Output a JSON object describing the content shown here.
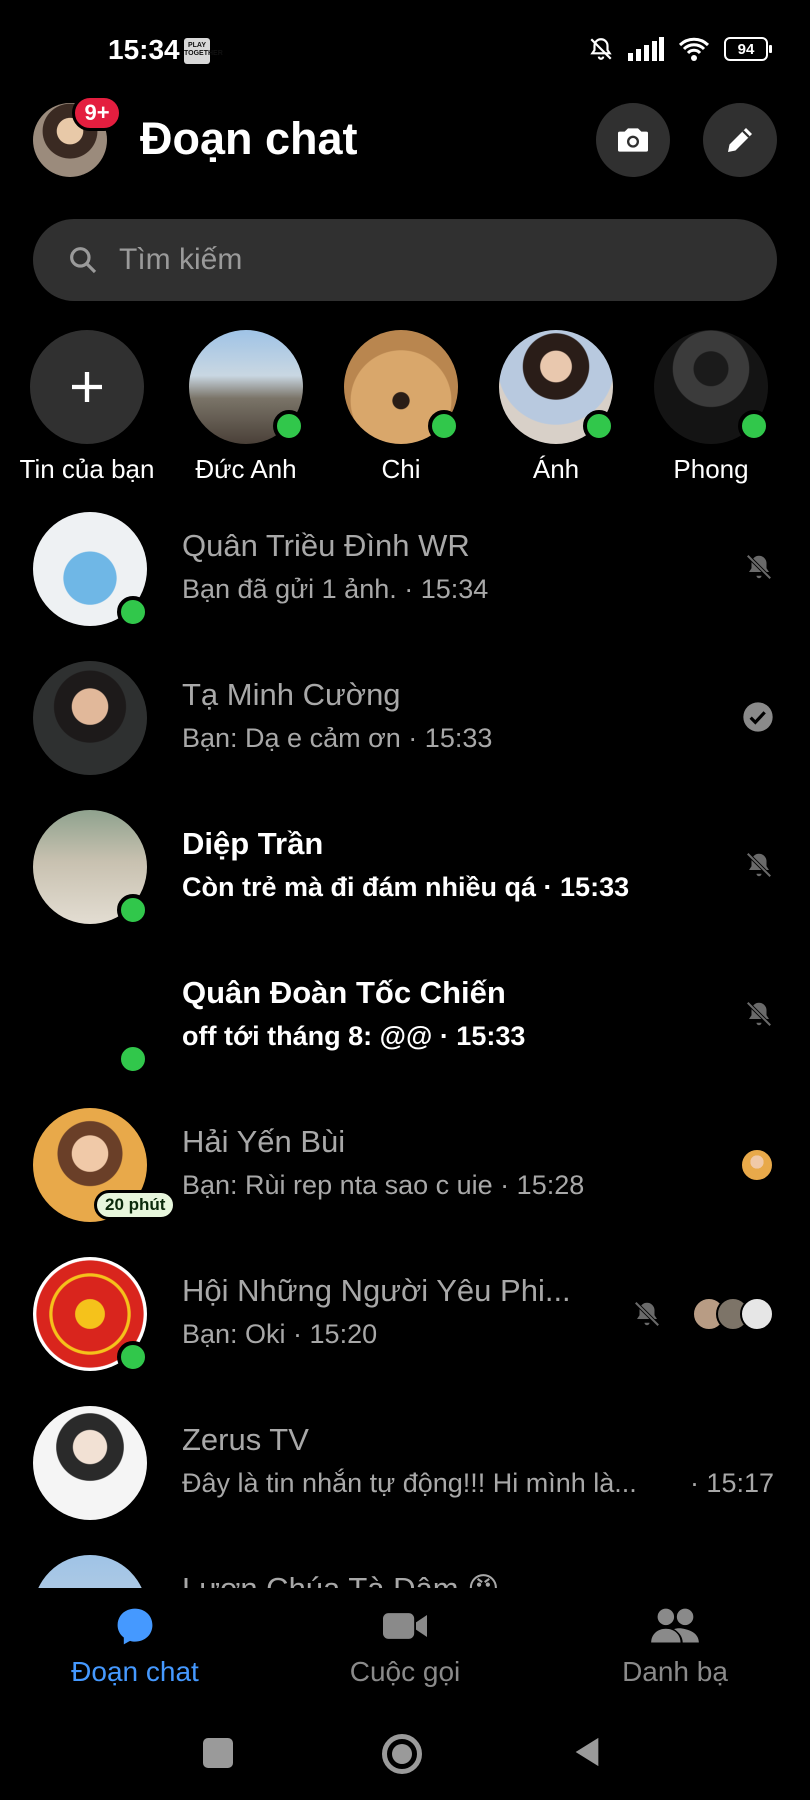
{
  "status_bar": {
    "time": "15:34",
    "app_tag": "PLAY TOGETHER",
    "battery": "94"
  },
  "header": {
    "title": "Đoạn chat",
    "notification_badge": "9+"
  },
  "search": {
    "placeholder": "Tìm kiếm"
  },
  "stories": [
    {
      "label": "Tin của bạn",
      "type": "add"
    },
    {
      "label": "Đức Anh",
      "online": true
    },
    {
      "label": "Chi",
      "online": true
    },
    {
      "label": "Ánh",
      "online": true
    },
    {
      "label": "Phong",
      "online": true
    }
  ],
  "chats": [
    {
      "name": "Quân Triều Đình WR",
      "preview": "Bạn đã gửi 1 ảnh. · 15:34",
      "unread": false,
      "online": true,
      "muted": true
    },
    {
      "name": "Tạ Minh Cường",
      "preview": "Bạn: Dạ e cảm ơn · 15:33",
      "unread": false,
      "online": false,
      "status": "sent"
    },
    {
      "name": "Diệp Trần",
      "preview": "Còn trẻ mà đi đám nhiều qá · 15:33",
      "unread": true,
      "online": true,
      "muted": true
    },
    {
      "name": "Quân Đoàn Tốc Chiến",
      "preview": "off tới tháng 8: @@ · 15:33",
      "unread": true,
      "online": true,
      "muted": true
    },
    {
      "name": "Hải Yến Bùi",
      "preview": "Bạn: Rùi rep nta sao c uie · 15:28",
      "unread": false,
      "active_badge": "20 phút",
      "status": "seen"
    },
    {
      "name": "Hội Những Người Yêu Phi...",
      "preview": "Bạn: Oki · 15:20",
      "unread": false,
      "online": true,
      "muted": true,
      "status": "seen-group"
    },
    {
      "name": "Zerus TV",
      "preview": "Đây là tin nhắn tự động!!! Hi mình là...",
      "time": "· 15:17",
      "unread": false
    },
    {
      "name": "Lươn Chúa Tà Dâm 😠",
      "preview": "",
      "unread": false
    }
  ],
  "nav": [
    {
      "label": "Đoạn chat",
      "active": true,
      "icon": "chat-bubble-icon"
    },
    {
      "label": "Cuộc gọi",
      "active": false,
      "icon": "video-camera-icon"
    },
    {
      "label": "Danh bạ",
      "active": false,
      "icon": "people-icon"
    }
  ],
  "colors": {
    "accent": "#4599ff",
    "online": "#31c74b",
    "badge": "#e41e3f",
    "surface": "#303030"
  }
}
